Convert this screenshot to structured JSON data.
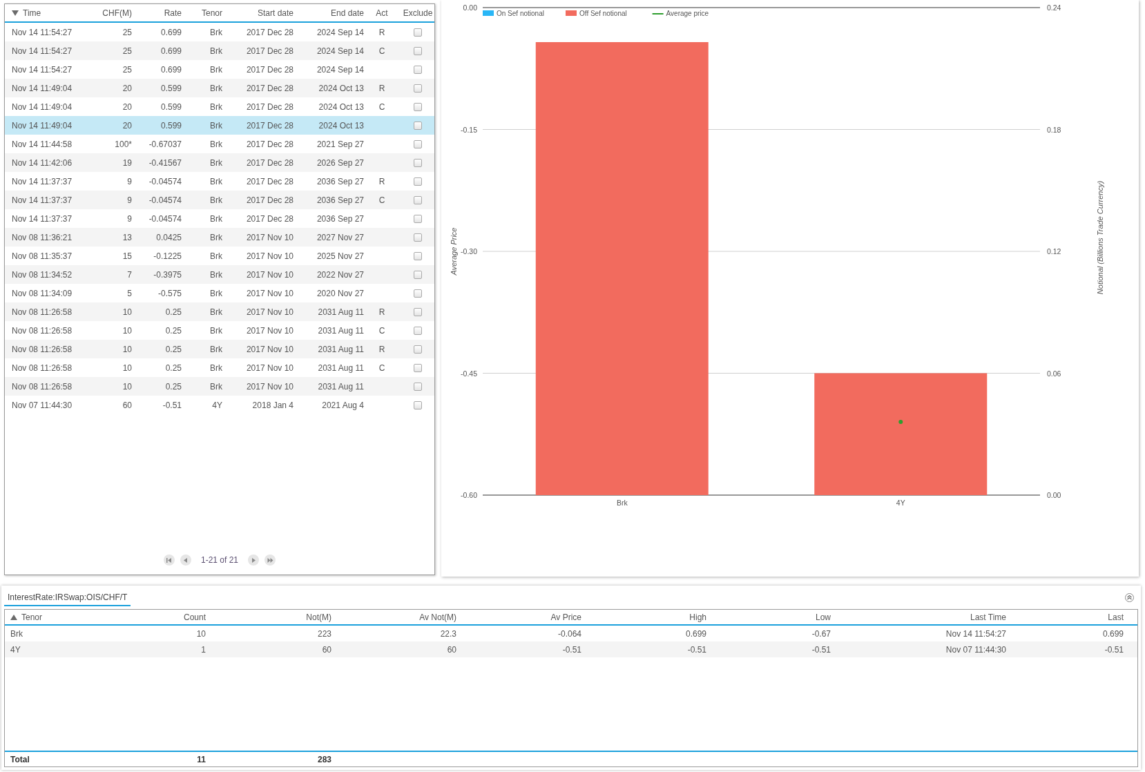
{
  "trades": {
    "columns": [
      {
        "label": "Time",
        "sorted": true
      },
      {
        "label": "CHF(M)"
      },
      {
        "label": "Rate"
      },
      {
        "label": "Tenor"
      },
      {
        "label": "Start date"
      },
      {
        "label": "End date"
      },
      {
        "label": "Act"
      },
      {
        "label": "Exclude"
      }
    ],
    "rows": [
      {
        "time": "Nov 14 11:54:27",
        "chf": "25",
        "rate": "0.699",
        "tenor": "Brk",
        "start": "2017 Dec 28",
        "end": "2024 Sep 14",
        "act": "R",
        "excluded": false,
        "selected": false
      },
      {
        "time": "Nov 14 11:54:27",
        "chf": "25",
        "rate": "0.699",
        "tenor": "Brk",
        "start": "2017 Dec 28",
        "end": "2024 Sep 14",
        "act": "C",
        "excluded": false,
        "selected": false
      },
      {
        "time": "Nov 14 11:54:27",
        "chf": "25",
        "rate": "0.699",
        "tenor": "Brk",
        "start": "2017 Dec 28",
        "end": "2024 Sep 14",
        "excluded": false,
        "selected": false
      },
      {
        "time": "Nov 14 11:49:04",
        "chf": "20",
        "rate": "0.599",
        "tenor": "Brk",
        "start": "2017 Dec 28",
        "end": "2024 Oct 13",
        "act": "R",
        "excluded": false,
        "selected": false
      },
      {
        "time": "Nov 14 11:49:04",
        "chf": "20",
        "rate": "0.599",
        "tenor": "Brk",
        "start": "2017 Dec 28",
        "end": "2024 Oct 13",
        "act": "C",
        "excluded": false,
        "selected": false
      },
      {
        "time": "Nov 14 11:49:04",
        "chf": "20",
        "rate": "0.599",
        "tenor": "Brk",
        "start": "2017 Dec 28",
        "end": "2024 Oct 13",
        "excluded": false,
        "selected": true
      },
      {
        "time": "Nov 14 11:44:58",
        "chf": "100*",
        "rate": "-0.67037",
        "tenor": "Brk",
        "start": "2017 Dec 28",
        "end": "2021 Sep 27",
        "excluded": false,
        "selected": false
      },
      {
        "time": "Nov 14 11:42:06",
        "chf": "19",
        "rate": "-0.41567",
        "tenor": "Brk",
        "start": "2017 Dec 28",
        "end": "2026 Sep 27",
        "excluded": false,
        "selected": false
      },
      {
        "time": "Nov 14 11:37:37",
        "chf": "9",
        "rate": "-0.04574",
        "tenor": "Brk",
        "start": "2017 Dec 28",
        "end": "2036 Sep 27",
        "act": "R",
        "excluded": false,
        "selected": false
      },
      {
        "time": "Nov 14 11:37:37",
        "chf": "9",
        "rate": "-0.04574",
        "tenor": "Brk",
        "start": "2017 Dec 28",
        "end": "2036 Sep 27",
        "act": "C",
        "excluded": false,
        "selected": false
      },
      {
        "time": "Nov 14 11:37:37",
        "chf": "9",
        "rate": "-0.04574",
        "tenor": "Brk",
        "start": "2017 Dec 28",
        "end": "2036 Sep 27",
        "excluded": false,
        "selected": false
      },
      {
        "time": "Nov 08 11:36:21",
        "chf": "13",
        "rate": "0.0425",
        "tenor": "Brk",
        "start": "2017 Nov 10",
        "end": "2027 Nov 27",
        "excluded": false,
        "selected": false
      },
      {
        "time": "Nov 08 11:35:37",
        "chf": "15",
        "rate": "-0.1225",
        "tenor": "Brk",
        "start": "2017 Nov 10",
        "end": "2025 Nov 27",
        "excluded": false,
        "selected": false
      },
      {
        "time": "Nov 08 11:34:52",
        "chf": "7",
        "rate": "-0.3975",
        "tenor": "Brk",
        "start": "2017 Nov 10",
        "end": "2022 Nov 27",
        "excluded": false,
        "selected": false
      },
      {
        "time": "Nov 08 11:34:09",
        "chf": "5",
        "rate": "-0.575",
        "tenor": "Brk",
        "start": "2017 Nov 10",
        "end": "2020 Nov 27",
        "excluded": false,
        "selected": false
      },
      {
        "time": "Nov 08 11:26:58",
        "chf": "10",
        "rate": "0.25",
        "tenor": "Brk",
        "start": "2017 Nov 10",
        "end": "2031 Aug 11",
        "act": "R",
        "excluded": false,
        "selected": false
      },
      {
        "time": "Nov 08 11:26:58",
        "chf": "10",
        "rate": "0.25",
        "tenor": "Brk",
        "start": "2017 Nov 10",
        "end": "2031 Aug 11",
        "act": "C",
        "excluded": false,
        "selected": false
      },
      {
        "time": "Nov 08 11:26:58",
        "chf": "10",
        "rate": "0.25",
        "tenor": "Brk",
        "start": "2017 Nov 10",
        "end": "2031 Aug 11",
        "act": "R",
        "excluded": false,
        "selected": false
      },
      {
        "time": "Nov 08 11:26:58",
        "chf": "10",
        "rate": "0.25",
        "tenor": "Brk",
        "start": "2017 Nov 10",
        "end": "2031 Aug 11",
        "act": "C",
        "excluded": false,
        "selected": false
      },
      {
        "time": "Nov 08 11:26:58",
        "chf": "10",
        "rate": "0.25",
        "tenor": "Brk",
        "start": "2017 Nov 10",
        "end": "2031 Aug 11",
        "excluded": false,
        "selected": false
      },
      {
        "time": "Nov 07 11:44:30",
        "chf": "60",
        "rate": "-0.51",
        "tenor": "4Y",
        "start": "2018 Jan 4",
        "end": "2021 Aug 4",
        "excluded": false,
        "selected": false
      }
    ],
    "pager": "1-21 of 21"
  },
  "chart": {
    "chart_data": {
      "type": "bar",
      "ylabel": "Average Price",
      "y2label": "Notional (Billions Trade Currency)",
      "categories": [
        "Brk",
        "4Y"
      ],
      "grid": true,
      "legend": "top-left",
      "series": [
        {
          "name": "On Sef notional",
          "color": "#29b6f6",
          "axis": "y2",
          "values": [
            0,
            0
          ]
        },
        {
          "name": "Off Sef notional",
          "color": "#f26b5e",
          "axis": "y2",
          "values": [
            0.223,
            0.06
          ]
        },
        {
          "name": "Average price",
          "color": "#2e9e2e",
          "type": "line",
          "marker": "circle",
          "values": [
            null,
            -0.51
          ]
        }
      ],
      "ylim": [
        -0.6,
        0
      ],
      "yticks": [
        {
          "value": 0,
          "label": "0.00"
        },
        {
          "value": -0.15,
          "label": "-0.15"
        },
        {
          "value": -0.3,
          "label": "-0.30"
        },
        {
          "value": -0.45,
          "label": "-0.45"
        },
        {
          "value": -0.6,
          "label": "-0.60"
        }
      ],
      "y2lim": [
        0,
        0.24
      ],
      "y2ticks": [
        {
          "value": 0.24,
          "label": "0.24"
        },
        {
          "value": 0.18,
          "label": "0.18"
        },
        {
          "value": 0.12,
          "label": "0.12"
        },
        {
          "value": 0.06,
          "label": "0.06"
        },
        {
          "value": 0,
          "label": "0.00"
        }
      ]
    }
  },
  "summary": {
    "tab": {
      "label": "InterestRate:IRSwap:OIS/CHF/T",
      "selected": true
    },
    "columns": [
      "Tenor",
      "Count",
      "Not(M)",
      "Av Not(M)",
      "Av Price",
      "High",
      "Low",
      "Last Time",
      "Last"
    ],
    "rows": [
      [
        "Brk",
        "10",
        "223",
        "22.3",
        "-0.064",
        "0.699",
        "-0.67",
        "Nov 14 11:54:27",
        "0.699"
      ],
      [
        "4Y",
        "1",
        "60",
        "60",
        "-0.51",
        "-0.51",
        "-0.51",
        "Nov 07 11:44:30",
        "-0.51"
      ]
    ],
    "total": [
      "Total",
      "11",
      "283"
    ]
  }
}
